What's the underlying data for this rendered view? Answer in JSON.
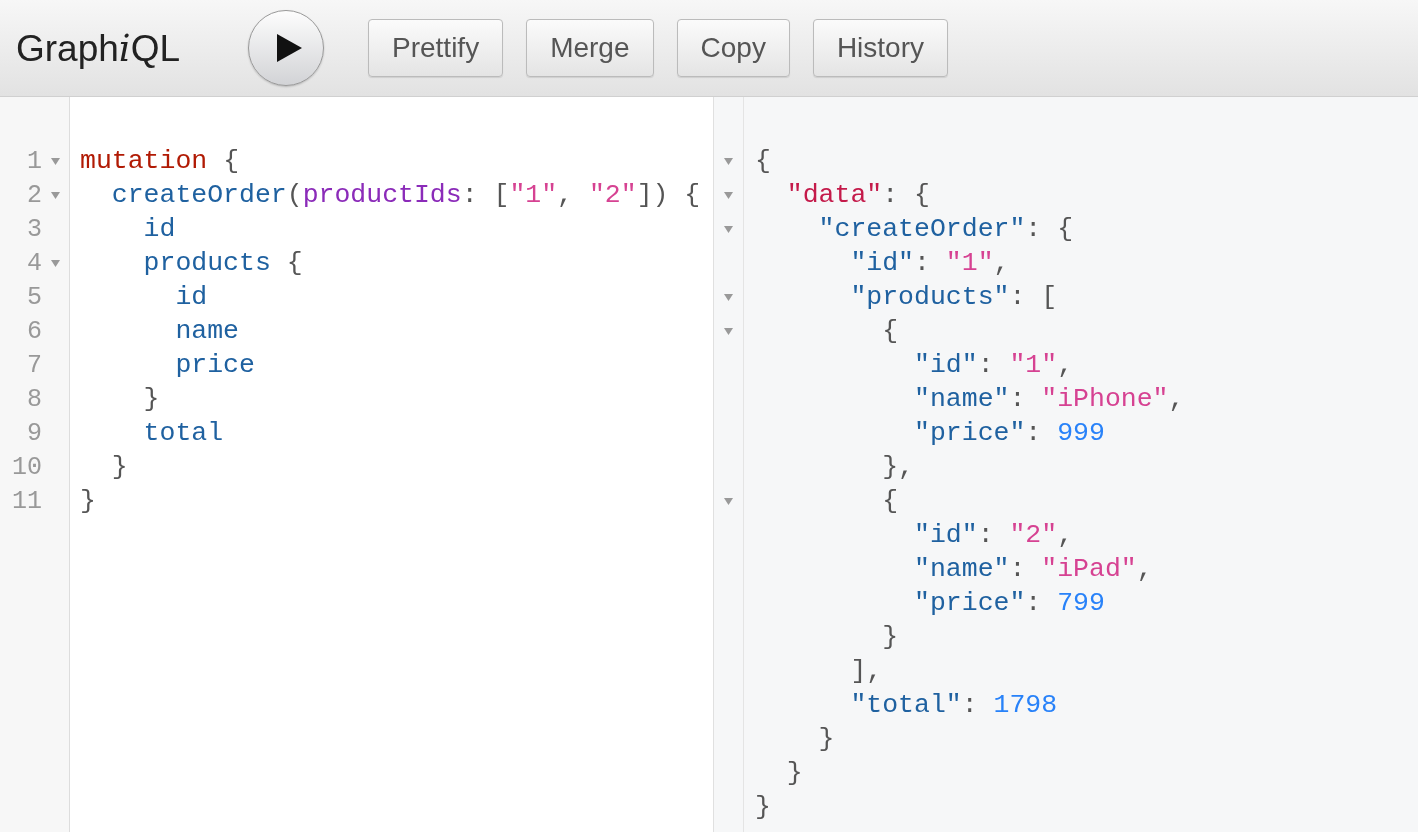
{
  "toolbar": {
    "logo": [
      {
        "text": "Graph",
        "italic": false
      },
      {
        "text": "i",
        "italic": true
      },
      {
        "text": "QL",
        "italic": false
      }
    ],
    "buttons": [
      "Prettify",
      "Merge",
      "Copy",
      "History"
    ]
  },
  "query_editor": {
    "lines": [
      {
        "number": "1",
        "foldable": true,
        "tokens": [
          {
            "kind": "keyword",
            "text": "mutation"
          },
          {
            "kind": "punctuation",
            "text": " {"
          }
        ]
      },
      {
        "number": "2",
        "foldable": true,
        "tokens": [
          {
            "kind": "property",
            "text": "  createOrder"
          },
          {
            "kind": "punctuation",
            "text": "("
          },
          {
            "kind": "attribute",
            "text": "productIds"
          },
          {
            "kind": "punctuation",
            "text": ": ["
          },
          {
            "kind": "string",
            "text": "\"1\""
          },
          {
            "kind": "punctuation",
            "text": ", "
          },
          {
            "kind": "string",
            "text": "\"2\""
          },
          {
            "kind": "punctuation",
            "text": "]) {"
          }
        ]
      },
      {
        "number": "3",
        "foldable": false,
        "tokens": [
          {
            "kind": "property",
            "text": "    id"
          }
        ]
      },
      {
        "number": "4",
        "foldable": true,
        "tokens": [
          {
            "kind": "property",
            "text": "    products"
          },
          {
            "kind": "punctuation",
            "text": " {"
          }
        ]
      },
      {
        "number": "5",
        "foldable": false,
        "tokens": [
          {
            "kind": "property",
            "text": "      id"
          }
        ]
      },
      {
        "number": "6",
        "foldable": false,
        "tokens": [
          {
            "kind": "property",
            "text": "      name"
          }
        ]
      },
      {
        "number": "7",
        "foldable": false,
        "tokens": [
          {
            "kind": "property",
            "text": "      price"
          }
        ]
      },
      {
        "number": "8",
        "foldable": false,
        "tokens": [
          {
            "kind": "punctuation",
            "text": "    }"
          }
        ]
      },
      {
        "number": "9",
        "foldable": false,
        "tokens": [
          {
            "kind": "property",
            "text": "    total"
          }
        ]
      },
      {
        "number": "10",
        "foldable": false,
        "tokens": [
          {
            "kind": "punctuation",
            "text": "  }"
          }
        ]
      },
      {
        "number": "11",
        "foldable": false,
        "tokens": [
          {
            "kind": "punctuation",
            "text": "}"
          }
        ]
      }
    ]
  },
  "result_viewer": {
    "lines": [
      {
        "foldable": true,
        "tokens": [
          {
            "kind": "punctuation",
            "text": "{"
          }
        ]
      },
      {
        "foldable": true,
        "tokens": [
          {
            "kind": "root-key",
            "text": "  \"data\""
          },
          {
            "kind": "punctuation",
            "text": ": {"
          }
        ]
      },
      {
        "foldable": true,
        "tokens": [
          {
            "kind": "property",
            "text": "    \"createOrder\""
          },
          {
            "kind": "punctuation",
            "text": ": {"
          }
        ]
      },
      {
        "foldable": false,
        "tokens": [
          {
            "kind": "property",
            "text": "      \"id\""
          },
          {
            "kind": "punctuation",
            "text": ": "
          },
          {
            "kind": "string",
            "text": "\"1\""
          },
          {
            "kind": "punctuation",
            "text": ","
          }
        ]
      },
      {
        "foldable": true,
        "tokens": [
          {
            "kind": "property",
            "text": "      \"products\""
          },
          {
            "kind": "punctuation",
            "text": ": ["
          }
        ]
      },
      {
        "foldable": true,
        "tokens": [
          {
            "kind": "punctuation",
            "text": "        {"
          }
        ]
      },
      {
        "foldable": false,
        "tokens": [
          {
            "kind": "property",
            "text": "          \"id\""
          },
          {
            "kind": "punctuation",
            "text": ": "
          },
          {
            "kind": "string",
            "text": "\"1\""
          },
          {
            "kind": "punctuation",
            "text": ","
          }
        ]
      },
      {
        "foldable": false,
        "tokens": [
          {
            "kind": "property",
            "text": "          \"name\""
          },
          {
            "kind": "punctuation",
            "text": ": "
          },
          {
            "kind": "string",
            "text": "\"iPhone\""
          },
          {
            "kind": "punctuation",
            "text": ","
          }
        ]
      },
      {
        "foldable": false,
        "tokens": [
          {
            "kind": "property",
            "text": "          \"price\""
          },
          {
            "kind": "punctuation",
            "text": ": "
          },
          {
            "kind": "number",
            "text": "999"
          }
        ]
      },
      {
        "foldable": false,
        "tokens": [
          {
            "kind": "punctuation",
            "text": "        },"
          }
        ]
      },
      {
        "foldable": true,
        "tokens": [
          {
            "kind": "punctuation",
            "text": "        {"
          }
        ]
      },
      {
        "foldable": false,
        "tokens": [
          {
            "kind": "property",
            "text": "          \"id\""
          },
          {
            "kind": "punctuation",
            "text": ": "
          },
          {
            "kind": "string",
            "text": "\"2\""
          },
          {
            "kind": "punctuation",
            "text": ","
          }
        ]
      },
      {
        "foldable": false,
        "tokens": [
          {
            "kind": "property",
            "text": "          \"name\""
          },
          {
            "kind": "punctuation",
            "text": ": "
          },
          {
            "kind": "string",
            "text": "\"iPad\""
          },
          {
            "kind": "punctuation",
            "text": ","
          }
        ]
      },
      {
        "foldable": false,
        "tokens": [
          {
            "kind": "property",
            "text": "          \"price\""
          },
          {
            "kind": "punctuation",
            "text": ": "
          },
          {
            "kind": "number",
            "text": "799"
          }
        ]
      },
      {
        "foldable": false,
        "tokens": [
          {
            "kind": "punctuation",
            "text": "        }"
          }
        ]
      },
      {
        "foldable": false,
        "tokens": [
          {
            "kind": "punctuation",
            "text": "      ],"
          }
        ]
      },
      {
        "foldable": false,
        "tokens": [
          {
            "kind": "property",
            "text": "      \"total\""
          },
          {
            "kind": "punctuation",
            "text": ": "
          },
          {
            "kind": "number",
            "text": "1798"
          }
        ]
      },
      {
        "foldable": false,
        "tokens": [
          {
            "kind": "punctuation",
            "text": "    }"
          }
        ]
      },
      {
        "foldable": false,
        "tokens": [
          {
            "kind": "punctuation",
            "text": "  }"
          }
        ]
      },
      {
        "foldable": false,
        "tokens": [
          {
            "kind": "punctuation",
            "text": "}"
          }
        ]
      }
    ]
  }
}
